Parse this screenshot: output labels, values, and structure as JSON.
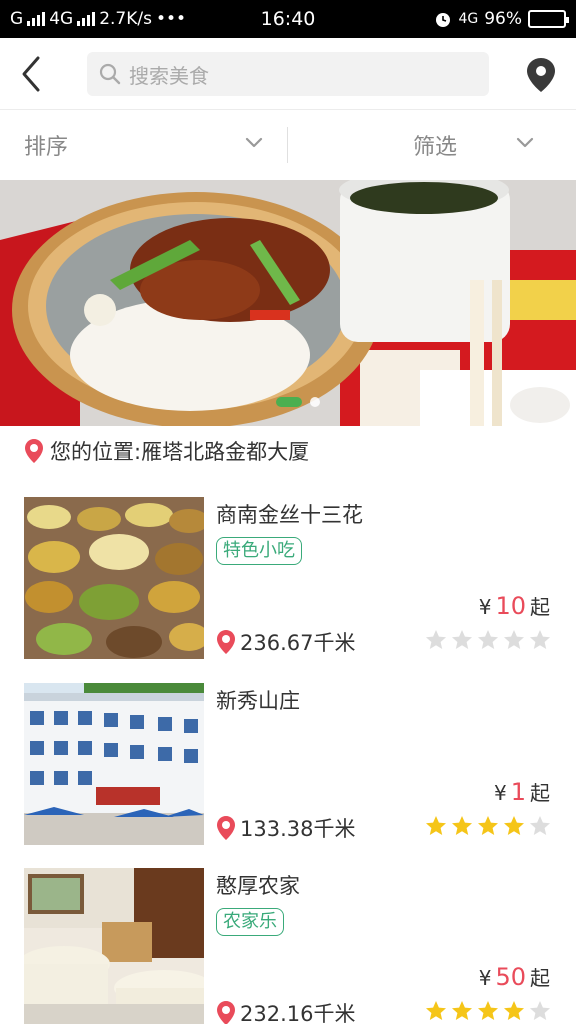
{
  "status_bar": {
    "carrier_left": "G",
    "network": "4G",
    "speed": "2.7K/s",
    "dots": "•••",
    "time": "16:40",
    "network_right": "4G",
    "battery": "96%"
  },
  "header": {
    "back_icon": "chevron-left-icon",
    "search_placeholder": "搜索美食",
    "location_icon": "map-pin-icon"
  },
  "filters": {
    "sort_label": "排序",
    "filter_label": "筛选"
  },
  "banner": {
    "slide_count": 2,
    "active_slide": 1
  },
  "location": {
    "text": "您的位置:雁塔北路金都大厦"
  },
  "restaurants": [
    {
      "name": "商南金丝十三花",
      "tag": "特色小吃",
      "price_prefix": "¥",
      "price": "10",
      "price_suffix": "起",
      "distance": "236.67千米",
      "rating": 0
    },
    {
      "name": "新秀山庄",
      "tag": "",
      "price_prefix": "¥",
      "price": "1",
      "price_suffix": "起",
      "distance": "133.38千米",
      "rating": 4
    },
    {
      "name": "憨厚农家",
      "tag": "农家乐",
      "price_prefix": "¥",
      "price": "50",
      "price_suffix": "起",
      "distance": "232.16千米",
      "rating": 4
    }
  ],
  "colors": {
    "accent_green": "#3aaa7a",
    "price_red": "#e94b5a",
    "pin_red": "#e94b5a",
    "star_yellow": "#f5c518",
    "star_gray": "#dddddd"
  }
}
